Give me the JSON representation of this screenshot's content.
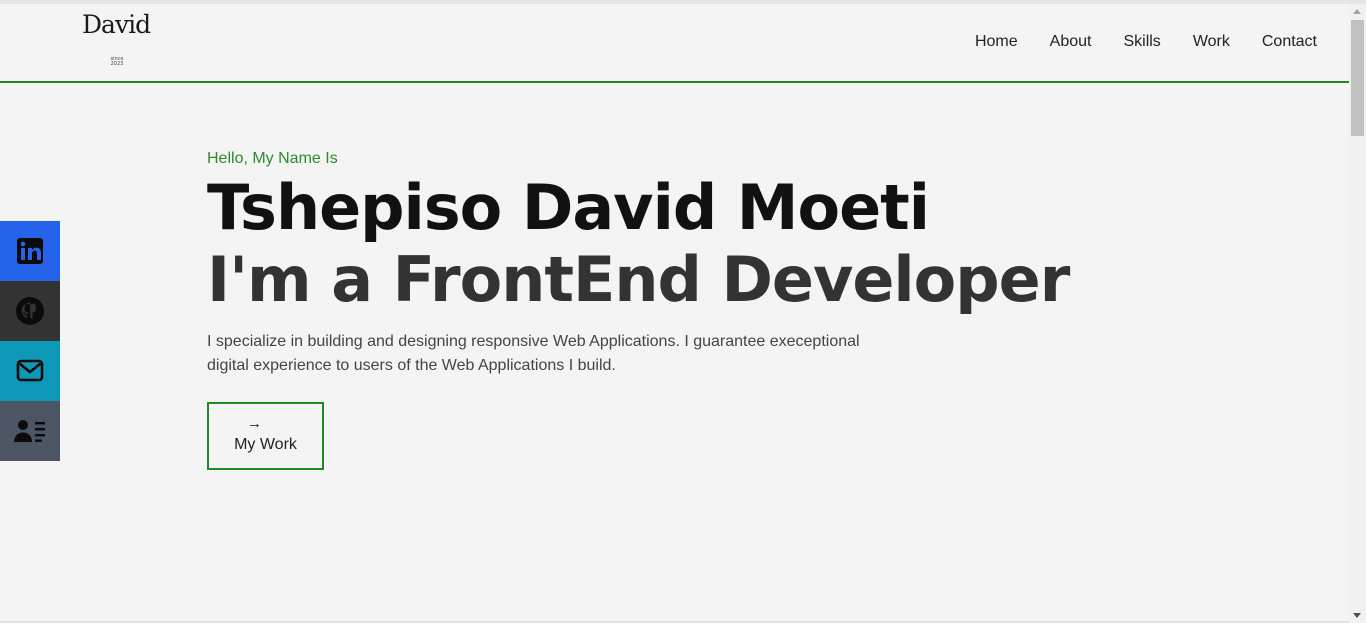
{
  "header": {
    "logo_text": "David",
    "logo_since": "since 2023",
    "nav": [
      "Home",
      "About",
      "Skills",
      "Work",
      "Contact"
    ]
  },
  "social": [
    {
      "name": "linkedin-icon",
      "color": "#2563eb"
    },
    {
      "name": "github-icon",
      "color": "#333333"
    },
    {
      "name": "mail-icon",
      "color": "#0e98b8"
    },
    {
      "name": "contact-card-icon",
      "color": "#4b5563"
    }
  ],
  "hero": {
    "greeting": "Hello, My Name Is",
    "name": "Tshepiso David Moeti",
    "role": "I'm a FrontEnd Developer",
    "description": "I specialize in building and designing responsive Web Applications. I guarantee execeptional digital experience to users of the Web Applications I build.",
    "button_arrow": "→",
    "button_label": "My Work"
  },
  "colors": {
    "accent": "#1f8a1f",
    "greeting": "#2e8b2e",
    "background": "#f4f4f4"
  }
}
